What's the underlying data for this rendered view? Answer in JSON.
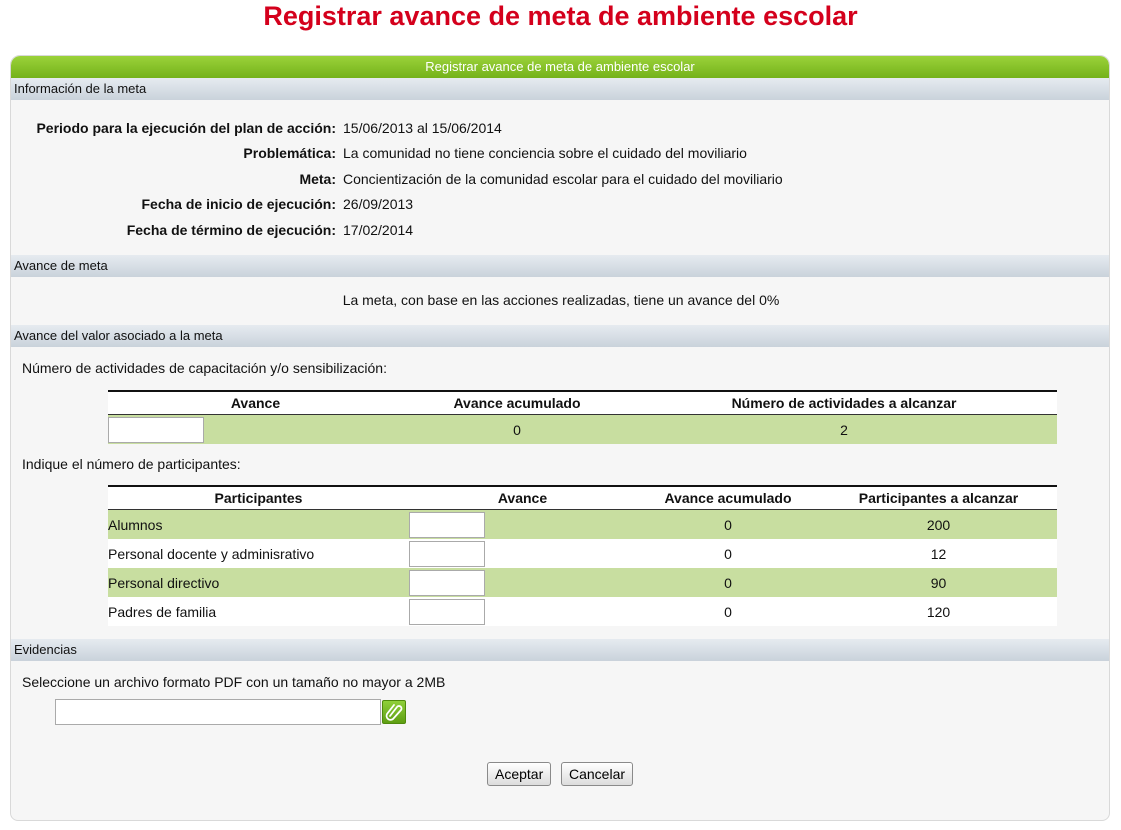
{
  "page_title": "Registrar avance de meta de ambiente escolar",
  "panel": {
    "header": "Registrar avance de meta de ambiente escolar"
  },
  "info_section": {
    "title": "Información de la meta",
    "rows": [
      {
        "label": "Periodo para la ejecución del plan de acción:",
        "value": "15/06/2013 al 15/06/2014"
      },
      {
        "label": "Problemática:",
        "value": "La comunidad no tiene conciencia sobre el cuidado del moviliario"
      },
      {
        "label": "Meta:",
        "value": "Concientización de la comunidad escolar para el cuidado del moviliario"
      },
      {
        "label": "Fecha de inicio de ejecución:",
        "value": "26/09/2013"
      },
      {
        "label": "Fecha de término de ejecución:",
        "value": "17/02/2014"
      }
    ]
  },
  "progress_section": {
    "title": "Avance de meta",
    "text": "La meta, con base en las acciones realizadas, tiene un avance del 0%"
  },
  "value_section": {
    "title": "Avance del valor asociado a la meta",
    "activities_prompt": "Número de actividades de capacitación y/o sensibilización:",
    "activities_table": {
      "headers": [
        "Avance",
        "Avance acumulado",
        "Número de actividades a alcanzar"
      ],
      "row": {
        "avance": "",
        "acumulado": "0",
        "alcanzar": "2"
      }
    },
    "participants_prompt": "Indique el número de participantes:",
    "participants_table": {
      "headers": [
        "Participantes",
        "Avance",
        "Avance acumulado",
        "Participantes a alcanzar"
      ],
      "rows": [
        {
          "name": "Alumnos",
          "avance": "",
          "acumulado": "0",
          "alcanzar": "200"
        },
        {
          "name": "Personal docente y adminisrativo",
          "avance": "",
          "acumulado": "0",
          "alcanzar": "12"
        },
        {
          "name": "Personal directivo",
          "avance": "",
          "acumulado": "0",
          "alcanzar": "90"
        },
        {
          "name": "Padres de familia",
          "avance": "",
          "acumulado": "0",
          "alcanzar": "120"
        }
      ]
    }
  },
  "evidence_section": {
    "title": "Evidencias",
    "prompt": "Seleccione un archivo formato PDF con un tamaño no mayor a 2MB",
    "file_value": "",
    "attach_icon": "paperclip-icon"
  },
  "buttons": {
    "accept": "Aceptar",
    "cancel": "Cancelar"
  },
  "colors": {
    "title": "#d4001c",
    "header_green": "#74b21a",
    "row_green": "#c8dea0"
  }
}
